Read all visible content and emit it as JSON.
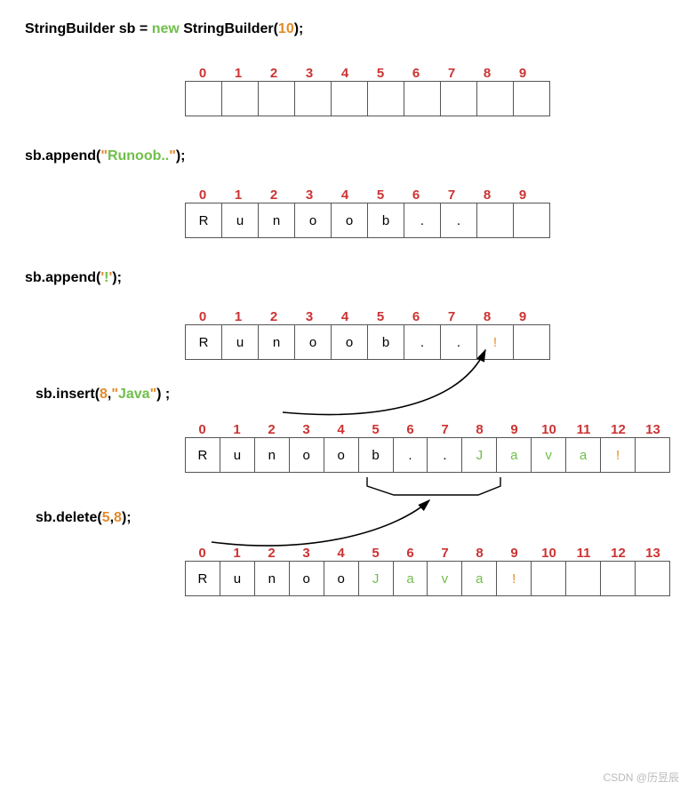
{
  "lines": {
    "l1_pre": "StringBuilder sb = ",
    "l1_new": "new",
    "l1_mid": " StringBuilder(",
    "l1_arg": "10",
    "l1_post": ");",
    "l2_pre": "sb.append(",
    "l2_q1": "\"",
    "l2_str": "Runoob..",
    "l2_q2": "\"",
    "l2_post": ");",
    "l3_pre": "sb.append(",
    "l3_q1": "'",
    "l3_str": "!",
    "l3_q2": "'",
    "l3_post": ");",
    "l4_pre": "sb.insert(",
    "l4_n": "8",
    "l4_comma": ",",
    "l4_q1": "\"",
    "l4_str": "Java",
    "l4_q2": "\"",
    "l4_post": ") ;",
    "l5_pre": "sb.delete(",
    "l5_a": "5",
    "l5_comma": ",",
    "l5_b": "8",
    "l5_post": ");"
  },
  "indices10": [
    "0",
    "1",
    "2",
    "3",
    "4",
    "5",
    "6",
    "7",
    "8",
    "9"
  ],
  "indices14": [
    "0",
    "1",
    "2",
    "3",
    "4",
    "5",
    "6",
    "7",
    "8",
    "9",
    "10",
    "11",
    "12",
    "13"
  ],
  "rows": {
    "r1": [
      "",
      "",
      "",
      "",
      "",
      "",
      "",
      "",
      "",
      ""
    ],
    "r2": [
      "R",
      "u",
      "n",
      "o",
      "o",
      "b",
      ".",
      ".",
      "",
      ""
    ],
    "r3": [
      "R",
      "u",
      "n",
      "o",
      "o",
      "b",
      ".",
      ".",
      "!",
      ""
    ],
    "r4": [
      "R",
      "u",
      "n",
      "o",
      "o",
      "b",
      ".",
      ".",
      "J",
      "a",
      "v",
      "a",
      "!",
      ""
    ],
    "r5": [
      "R",
      "u",
      "n",
      "o",
      "o",
      "J",
      "a",
      "v",
      "a",
      "!",
      "",
      "",
      "",
      ""
    ]
  },
  "r3_highlight": {
    "8": "orange"
  },
  "r4_highlight": {
    "8": "green",
    "9": "green",
    "10": "green",
    "11": "green",
    "12": "orange"
  },
  "r5_highlight": {
    "5": "green",
    "6": "green",
    "7": "green",
    "8": "green",
    "9": "orange"
  },
  "watermark": "CSDN @历昱辰"
}
